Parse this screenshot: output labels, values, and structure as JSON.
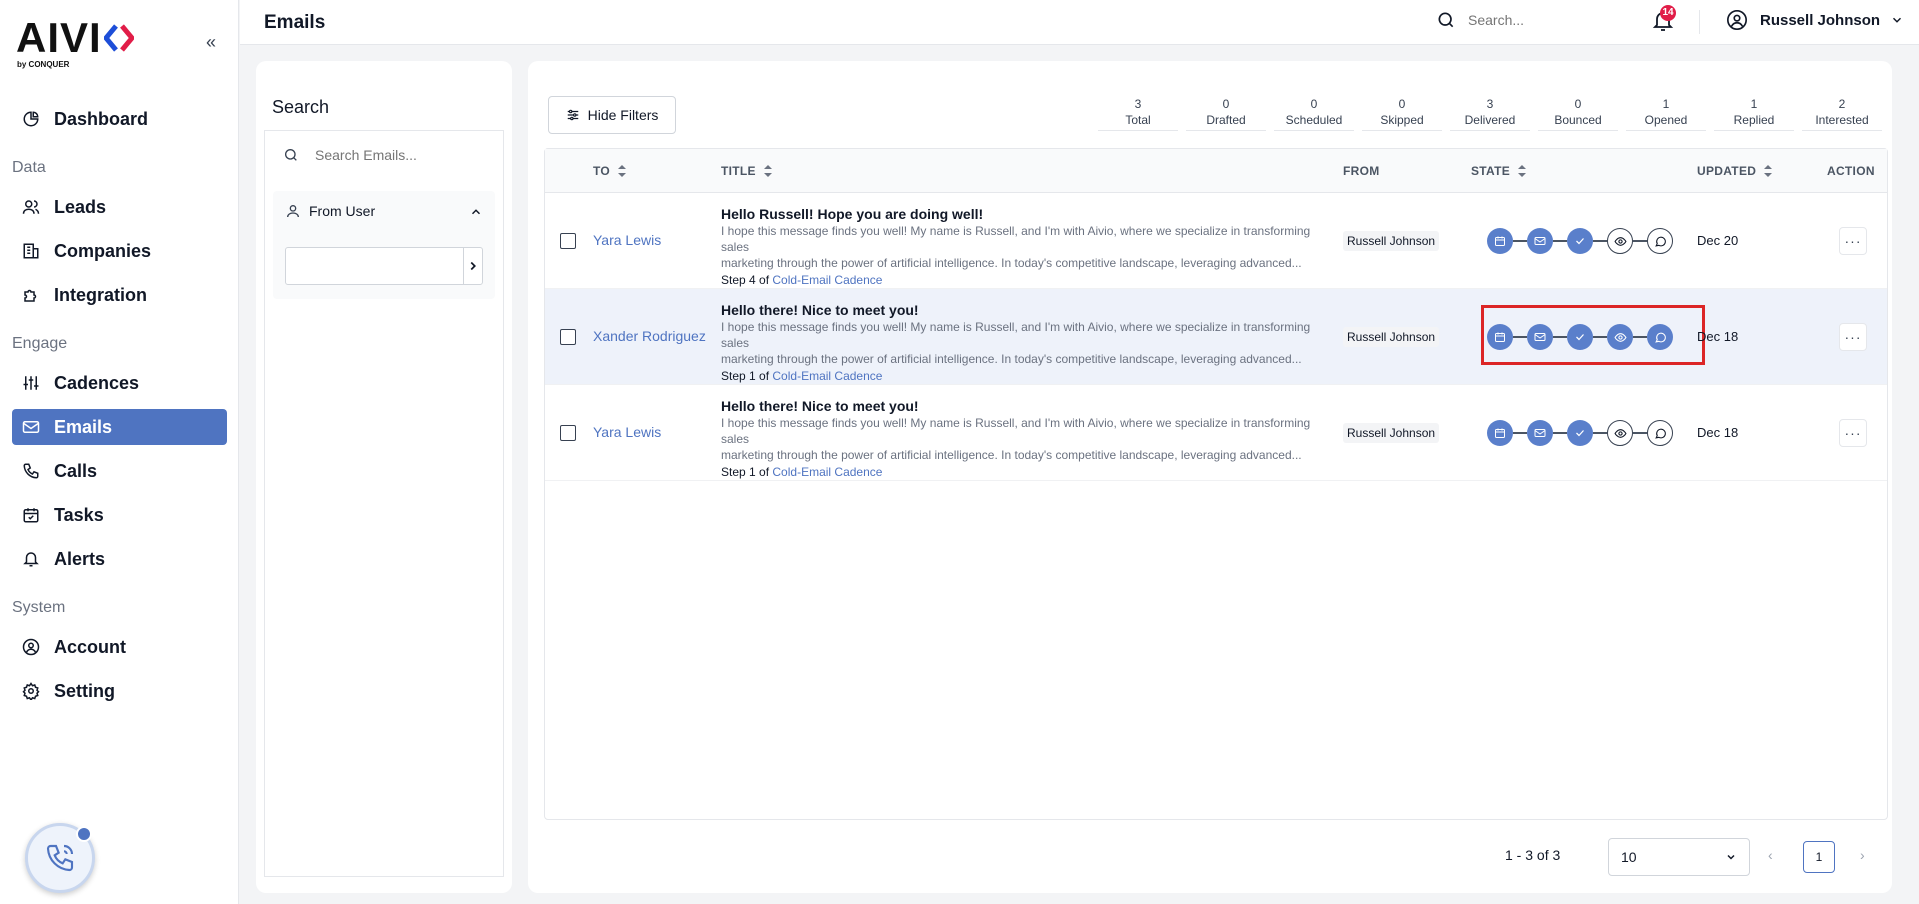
{
  "brand": {
    "logo_text": "AIVI",
    "logo_sub": "by CONQUER"
  },
  "sidebar": {
    "collapse_label": "«",
    "items": [
      {
        "label": "Dashboard",
        "icon": "dashboard-icon"
      },
      {
        "section": "Data"
      },
      {
        "label": "Leads",
        "icon": "users-icon"
      },
      {
        "label": "Companies",
        "icon": "building-icon"
      },
      {
        "label": "Integration",
        "icon": "puzzle-icon"
      },
      {
        "section": "Engage"
      },
      {
        "label": "Cadences",
        "icon": "sliders-icon"
      },
      {
        "label": "Emails",
        "icon": "mail-icon",
        "active": true
      },
      {
        "label": "Calls",
        "icon": "phone-icon"
      },
      {
        "label": "Tasks",
        "icon": "calendar-check-icon"
      },
      {
        "label": "Alerts",
        "icon": "bell-icon"
      },
      {
        "section": "System"
      },
      {
        "label": "Account",
        "icon": "user-circle-icon"
      },
      {
        "label": "Setting",
        "icon": "gear-icon"
      }
    ],
    "labels": {
      "dashboard": "Dashboard",
      "data": "Data",
      "leads": "Leads",
      "companies": "Companies",
      "integration": "Integration",
      "engage": "Engage",
      "cadences": "Cadences",
      "emails": "Emails",
      "calls": "Calls",
      "tasks": "Tasks",
      "alerts": "Alerts",
      "system": "System",
      "account": "Account",
      "setting": "Setting"
    }
  },
  "header": {
    "title": "Emails",
    "search_placeholder": "Search...",
    "notifications_count": "14",
    "user_name": "Russell Johnson"
  },
  "search_panel": {
    "title": "Search",
    "search_placeholder": "Search Emails...",
    "from_user_label": "From User",
    "from_user_value": ""
  },
  "filters": {
    "hide_filters_label": "Hide Filters",
    "stats": [
      {
        "count": "3",
        "label": "Total"
      },
      {
        "count": "0",
        "label": "Drafted"
      },
      {
        "count": "0",
        "label": "Scheduled"
      },
      {
        "count": "0",
        "label": "Skipped"
      },
      {
        "count": "3",
        "label": "Delivered"
      },
      {
        "count": "0",
        "label": "Bounced"
      },
      {
        "count": "1",
        "label": "Opened"
      },
      {
        "count": "1",
        "label": "Replied"
      },
      {
        "count": "2",
        "label": "Interested"
      }
    ]
  },
  "table": {
    "columns": {
      "to": "TO",
      "title": "TITLE",
      "from": "FROM",
      "state": "STATE",
      "updated": "UPDATED",
      "action": "ACTION"
    },
    "state_icons": [
      "calendar-icon",
      "mail-icon",
      "check-icon",
      "eye-icon",
      "chat-icon"
    ],
    "rows": [
      {
        "to": "Yara Lewis",
        "subject": "Hello Russell! Hope you are doing well!",
        "body_line1": "I hope this message finds you well! My name is Russell, and I'm with Aivio, where we specialize in transforming sales",
        "body_line2": "marketing through the power of artificial intelligence. In today's competitive landscape, leveraging advanced...",
        "step": "Step 4 of",
        "cadence": "Cold-Email Cadence",
        "from": "Russell Johnson",
        "states_on": [
          true,
          true,
          true,
          false,
          false
        ],
        "updated": "Dec 20",
        "action": "···"
      },
      {
        "to": "Xander Rodriguez",
        "subject": "Hello there! Nice to meet you!",
        "body_line1": "I hope this message finds you well! My name is Russell, and I'm with Aivio, where we specialize in transforming sales",
        "body_line2": "marketing through the power of artificial intelligence. In today's competitive landscape, leveraging advanced...",
        "step": "Step 1 of",
        "cadence": "Cold-Email Cadence",
        "from": "Russell Johnson",
        "states_on": [
          true,
          true,
          true,
          true,
          true
        ],
        "updated": "Dec 18",
        "action": "···"
      },
      {
        "to": "Yara Lewis",
        "subject": "Hello there! Nice to meet you!",
        "body_line1": "I hope this message finds you well! My name is Russell, and I'm with Aivio, where we specialize in transforming sales",
        "body_line2": "marketing through the power of artificial intelligence. In today's competitive landscape, leveraging advanced...",
        "step": "Step 1 of",
        "cadence": "Cold-Email Cadence",
        "from": "Russell Johnson",
        "states_on": [
          true,
          true,
          true,
          false,
          false
        ],
        "updated": "Dec 18",
        "action": "···"
      }
    ]
  },
  "pagination": {
    "range": "1 - 3 of 3",
    "page_size": "10",
    "current_page": "1"
  },
  "colors": {
    "accent": "#4f74c1",
    "highlight_box": "#dc2626",
    "badge": "#e11d48"
  }
}
